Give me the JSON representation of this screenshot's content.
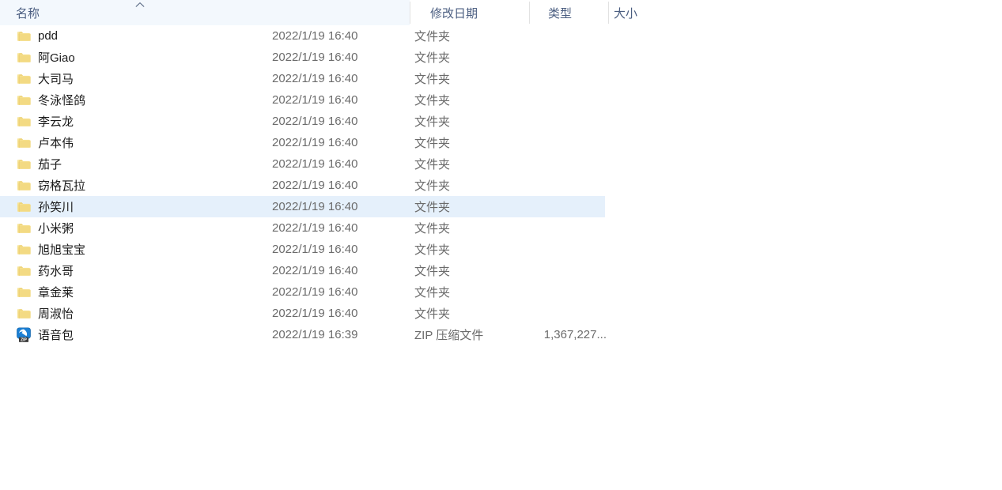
{
  "columns": {
    "name": {
      "label": "名称",
      "sort": "ascending",
      "sort_icon": "chevron-up-icon"
    },
    "date": {
      "label": "修改日期"
    },
    "type": {
      "label": "类型"
    },
    "size": {
      "label": "大小"
    }
  },
  "colors": {
    "header_text": "#4a5d80",
    "selection": "#e5f0fb",
    "folder_icon": "#f5dd8d",
    "zip_icon": "#1b7fd4",
    "row_text": "#1a1a1a",
    "secondary_text": "#6b6b6b",
    "divider": "#e2e2e2"
  },
  "rows": [
    {
      "icon": "folder-icon",
      "name": "pdd",
      "date": "2022/1/19 16:40",
      "type": "文件夹",
      "size": "",
      "selected": false
    },
    {
      "icon": "folder-icon",
      "name": "阿Giao",
      "date": "2022/1/19 16:40",
      "type": "文件夹",
      "size": "",
      "selected": false
    },
    {
      "icon": "folder-icon",
      "name": "大司马",
      "date": "2022/1/19 16:40",
      "type": "文件夹",
      "size": "",
      "selected": false
    },
    {
      "icon": "folder-icon",
      "name": "冬泳怪鸽",
      "date": "2022/1/19 16:40",
      "type": "文件夹",
      "size": "",
      "selected": false
    },
    {
      "icon": "folder-icon",
      "name": "李云龙",
      "date": "2022/1/19 16:40",
      "type": "文件夹",
      "size": "",
      "selected": false
    },
    {
      "icon": "folder-icon",
      "name": "卢本伟",
      "date": "2022/1/19 16:40",
      "type": "文件夹",
      "size": "",
      "selected": false
    },
    {
      "icon": "folder-icon",
      "name": "茄子",
      "date": "2022/1/19 16:40",
      "type": "文件夹",
      "size": "",
      "selected": false
    },
    {
      "icon": "folder-icon",
      "name": "窃格瓦拉",
      "date": "2022/1/19 16:40",
      "type": "文件夹",
      "size": "",
      "selected": false
    },
    {
      "icon": "folder-icon",
      "name": "孙笑川",
      "date": "2022/1/19 16:40",
      "type": "文件夹",
      "size": "",
      "selected": true
    },
    {
      "icon": "folder-icon",
      "name": "小米粥",
      "date": "2022/1/19 16:40",
      "type": "文件夹",
      "size": "",
      "selected": false
    },
    {
      "icon": "folder-icon",
      "name": "旭旭宝宝",
      "date": "2022/1/19 16:40",
      "type": "文件夹",
      "size": "",
      "selected": false
    },
    {
      "icon": "folder-icon",
      "name": "药水哥",
      "date": "2022/1/19 16:40",
      "type": "文件夹",
      "size": "",
      "selected": false
    },
    {
      "icon": "folder-icon",
      "name": "章金莱",
      "date": "2022/1/19 16:40",
      "type": "文件夹",
      "size": "",
      "selected": false
    },
    {
      "icon": "folder-icon",
      "name": "周淑怡",
      "date": "2022/1/19 16:40",
      "type": "文件夹",
      "size": "",
      "selected": false
    },
    {
      "icon": "zip-icon",
      "name": "语音包",
      "date": "2022/1/19 16:39",
      "type": "ZIP 压缩文件",
      "size": "1,367,227...",
      "selected": false
    }
  ]
}
